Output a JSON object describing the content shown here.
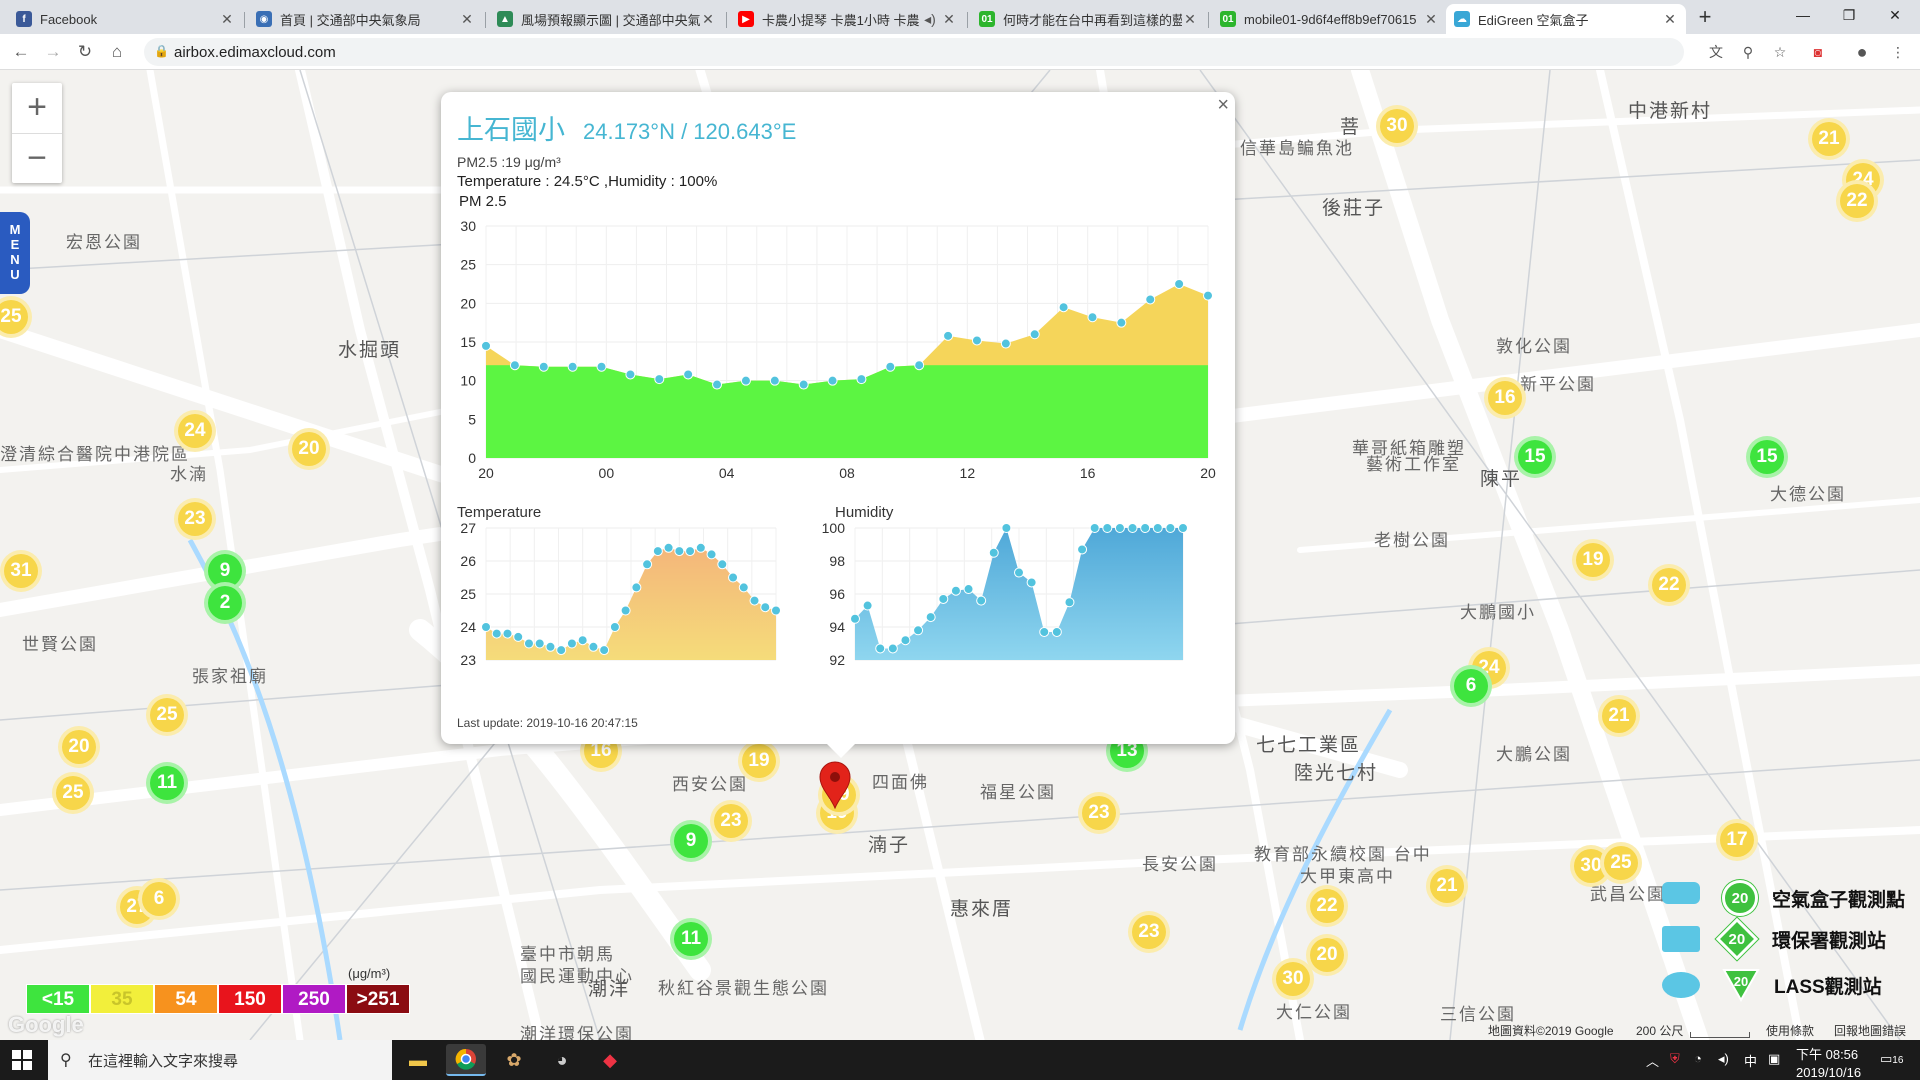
{
  "browser": {
    "tabs": [
      {
        "title": "Facebook",
        "icon": "facebook-icon",
        "color": "#3b5998"
      },
      {
        "title": "首頁 | 交通部中央氣象局",
        "icon": "cwb-icon",
        "color": "#3a6fb5"
      },
      {
        "title": "風場預報顯示圖 | 交通部中央氣象",
        "icon": "map-icon",
        "color": "#2e8b57"
      },
      {
        "title": "卡農小提琴 卡農1小時 卡農(",
        "icon": "youtube-icon",
        "color": "#ff0000"
      },
      {
        "title": "何時才能在台中再看到這樣的藍",
        "icon": "mobile01-icon",
        "color": "#2db52d"
      },
      {
        "title": "mobile01-9d6f4eff8b9ef70615",
        "icon": "mobile01-icon",
        "color": "#2db52d"
      },
      {
        "title": "EdiGreen 空氣盒子",
        "icon": "edigreen-icon",
        "color": "#39a7d6"
      }
    ],
    "new_tab": "+",
    "window": {
      "minimize": "—",
      "restore": "❐",
      "close": "✕"
    },
    "url": "airbox.edimaxcloud.com"
  },
  "map": {
    "zoom_in": "+",
    "zoom_out": "−",
    "menu_label": "MENU",
    "place_labels": [
      "水掘頭",
      "世賢公園",
      "宏恩公園",
      "張家祖廟",
      "後莊子",
      "菩",
      "中港新村",
      "敦化公園",
      "新平公園",
      "華哥紙箱雕塑",
      "藝術工作室",
      "老樹公園",
      "陳平",
      "大鵬國小",
      "大鵬公園",
      "陸光七村",
      "福星公園",
      "西安公園",
      "四面佛",
      "湳子",
      "惠來厝",
      "長安公園",
      "教育部永續校園 台中",
      "大甲東高中",
      "臺中市朝馬",
      "國民運動中心",
      "潮洋",
      "秋紅谷景觀生態公園",
      "潮洋環保公園",
      "三信公園",
      "武昌公園",
      "大德公園",
      "七七工業區",
      "澄清綜合醫院中港院區",
      "信華島鳊魚池",
      "水湳",
      "大仁公園"
    ],
    "clusters": [
      {
        "v": "30",
        "c": "y"
      },
      {
        "v": "21",
        "c": "y"
      },
      {
        "v": "24",
        "c": "y"
      },
      {
        "v": "22",
        "c": "y"
      },
      {
        "v": "16",
        "c": "y"
      },
      {
        "v": "15",
        "c": "g"
      },
      {
        "v": "15",
        "c": "g"
      },
      {
        "v": "19",
        "c": "y"
      },
      {
        "v": "22",
        "c": "y"
      },
      {
        "v": "24",
        "c": "y"
      },
      {
        "v": "6",
        "c": "g"
      },
      {
        "v": "21",
        "c": "y"
      },
      {
        "v": "17",
        "c": "y"
      },
      {
        "v": "30",
        "c": "y"
      },
      {
        "v": "25",
        "c": "y"
      },
      {
        "v": "21",
        "c": "y"
      },
      {
        "v": "22",
        "c": "y"
      },
      {
        "v": "20",
        "c": "y"
      },
      {
        "v": "30",
        "c": "y"
      },
      {
        "v": "23",
        "c": "y"
      },
      {
        "v": "23",
        "c": "y"
      },
      {
        "v": "13",
        "c": "g"
      },
      {
        "v": "16",
        "c": "y"
      },
      {
        "v": "19",
        "c": "y"
      },
      {
        "v": "23",
        "c": "y"
      },
      {
        "v": "9",
        "c": "g"
      },
      {
        "v": "11",
        "c": "g"
      },
      {
        "v": "19",
        "c": "y"
      },
      {
        "v": "24",
        "c": "y"
      },
      {
        "v": "20",
        "c": "y"
      },
      {
        "v": "23",
        "c": "y"
      },
      {
        "v": "9",
        "c": "g"
      },
      {
        "v": "2",
        "c": "g"
      },
      {
        "v": "31",
        "c": "y"
      },
      {
        "v": "25",
        "c": "y"
      },
      {
        "v": "20",
        "c": "y"
      },
      {
        "v": "25",
        "c": "y"
      },
      {
        "v": "11",
        "c": "g"
      },
      {
        "v": "27",
        "c": "y"
      },
      {
        "v": "6",
        "c": "y"
      },
      {
        "v": "25",
        "c": "y"
      }
    ],
    "legend": [
      {
        "label": "<15",
        "color": "#3ee43e"
      },
      {
        "label": "35",
        "color": "#f2ef3b"
      },
      {
        "label": "54",
        "color": "#f7921e"
      },
      {
        "label": "150",
        "color": "#e8141c"
      },
      {
        "label": "250",
        "color": "#b01ac4"
      },
      {
        "label": ">251",
        "color": "#8b0c12"
      }
    ],
    "legend_unit": "(μg/m³)",
    "station_types": [
      {
        "label": "空氣盒子觀測點",
        "value": "20",
        "color": "#3fc13f"
      },
      {
        "label": "環保署觀測站",
        "value": "20",
        "color": "#3fc13f"
      },
      {
        "label": "LASS觀測站",
        "value": "20",
        "color": "#3fc13f"
      }
    ],
    "attribution": "地圖資料©2019 Google",
    "scale": "200 公尺",
    "terms": "使用條款",
    "report": "回報地圖錯誤",
    "google_logo": "Google",
    "marker_value": "19"
  },
  "popup": {
    "close": "×",
    "station_name": "上石國小",
    "coords": "24.173°N / 120.643°E",
    "pm25_line": "PM2.5 :19 μg/m³",
    "env_line": "Temperature : 24.5°C ,Humidity : 100%",
    "pm_chart_title": "PM 2.5",
    "temp_chart_title": "Temperature",
    "hum_chart_title": "Humidity",
    "last_update": "Last update: 2019-10-16 20:47:15"
  },
  "chart_data": [
    {
      "type": "area",
      "title": "PM 2.5",
      "x_ticks": [
        "20",
        "00",
        "04",
        "08",
        "12",
        "16",
        "20"
      ],
      "ylim": [
        0,
        30
      ],
      "y_ticks": [
        0,
        5,
        10,
        15,
        20,
        25,
        30
      ],
      "threshold": 12,
      "values": [
        14.5,
        12,
        11.8,
        11.8,
        11.8,
        10.8,
        10.2,
        10.8,
        9.5,
        10,
        10,
        9.5,
        10,
        10.2,
        11.8,
        12,
        15.8,
        15.2,
        14.8,
        16,
        19.5,
        18.2,
        17.5,
        20.5,
        22.5,
        21
      ]
    },
    {
      "type": "area",
      "title": "Temperature",
      "ylim": [
        23,
        27
      ],
      "y_ticks": [
        23,
        24,
        25,
        26,
        27
      ],
      "values": [
        24,
        23.8,
        23.8,
        23.7,
        23.5,
        23.5,
        23.4,
        23.3,
        23.5,
        23.6,
        23.4,
        23.3,
        24,
        24.5,
        25.2,
        25.9,
        26.3,
        26.4,
        26.3,
        26.3,
        26.4,
        26.2,
        25.9,
        25.5,
        25.2,
        24.8,
        24.6,
        24.5
      ]
    },
    {
      "type": "area",
      "title": "Humidity",
      "ylim": [
        92,
        100
      ],
      "y_ticks": [
        92,
        94,
        96,
        98,
        100
      ],
      "values": [
        94.5,
        95.3,
        92.7,
        92.7,
        93.2,
        93.8,
        94.6,
        95.7,
        96.2,
        96.3,
        95.6,
        98.5,
        100,
        97.3,
        96.7,
        93.7,
        93.7,
        95.5,
        98.7,
        100,
        100,
        100,
        100,
        100,
        100,
        100,
        100
      ]
    }
  ],
  "taskbar": {
    "search_placeholder": "在這裡輸入文字來搜尋",
    "time": "下午 08:56",
    "date": "2019/10/16",
    "ime": "中",
    "notif_count": "16"
  }
}
